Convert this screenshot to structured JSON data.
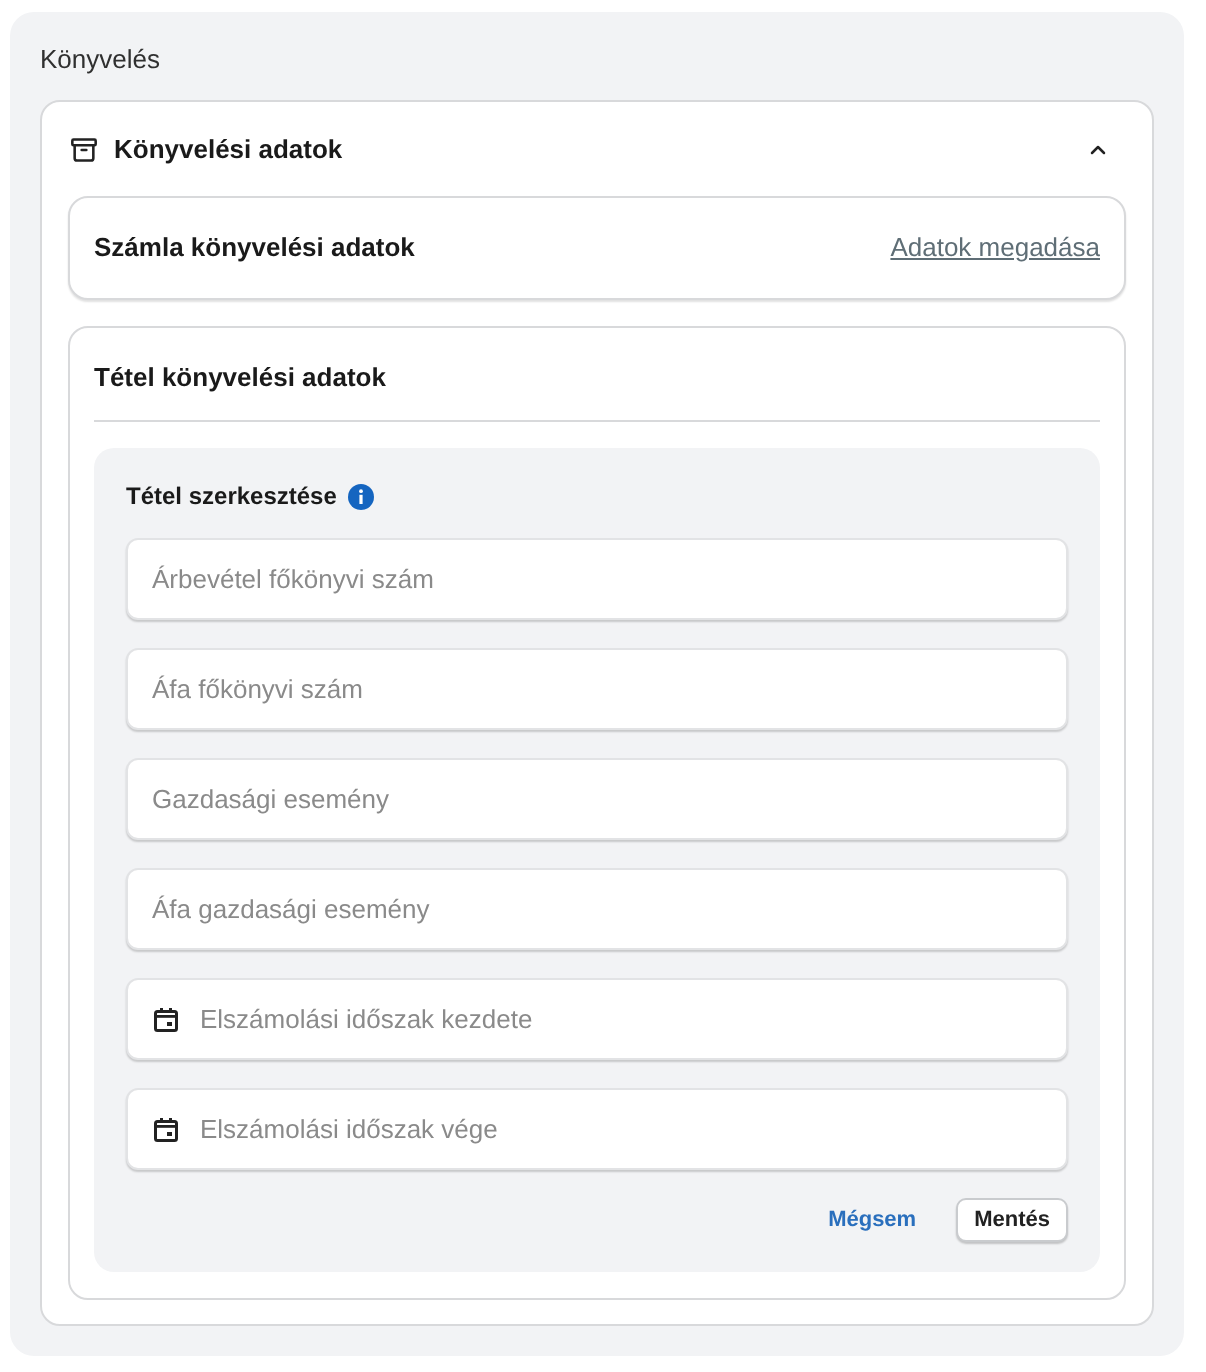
{
  "section_title": "Könyvelés",
  "accordion": {
    "title": "Könyvelési adatok",
    "expanded": true,
    "invoice_card": {
      "title": "Számla könyvelési adatok",
      "link": "Adatok megadása"
    },
    "item_card": {
      "title": "Tétel könyvelési adatok",
      "editor": {
        "title": "Tétel szerkesztése",
        "fields": [
          {
            "kind": "text",
            "placeholder": "Árbevétel főkönyvi szám"
          },
          {
            "kind": "text",
            "placeholder": "Áfa főkönyvi szám"
          },
          {
            "kind": "text",
            "placeholder": "Gazdasági esemény"
          },
          {
            "kind": "text",
            "placeholder": "Áfa gazdasági esemény"
          },
          {
            "kind": "date",
            "placeholder": "Elszámolási időszak kezdete"
          },
          {
            "kind": "date",
            "placeholder": "Elszámolási időszak vége"
          }
        ],
        "buttons": [
          {
            "kind": "link",
            "label": "Mégsem"
          },
          {
            "kind": "outlined",
            "label": "Mentés"
          }
        ]
      }
    }
  }
}
